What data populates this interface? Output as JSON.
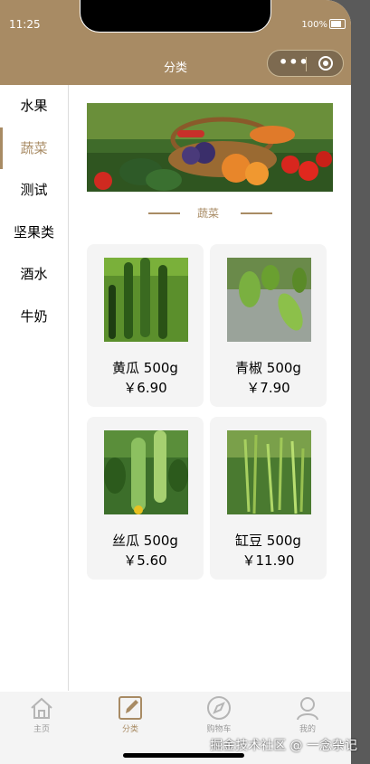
{
  "status_bar": {
    "time": "11:25",
    "battery": "100%"
  },
  "navbar": {
    "title": "分类",
    "more_glyph": "•••"
  },
  "sidebar": {
    "items": [
      {
        "label": "水果"
      },
      {
        "label": "蔬菜",
        "active": true
      },
      {
        "label": "测试"
      },
      {
        "label": "坚果类"
      },
      {
        "label": "酒水"
      },
      {
        "label": "牛奶"
      }
    ]
  },
  "section": {
    "title": "蔬菜"
  },
  "products": [
    {
      "name": "黄瓜 500g",
      "price": "￥6.90"
    },
    {
      "name": "青椒 500g",
      "price": "￥7.90"
    },
    {
      "name": "丝瓜 500g",
      "price": "￥5.60"
    },
    {
      "name": "缸豆 500g",
      "price": "￥11.90"
    }
  ],
  "tabbar": {
    "items": [
      {
        "label": "主页",
        "icon": "home-icon"
      },
      {
        "label": "分类",
        "icon": "edit-icon",
        "active": true
      },
      {
        "label": "购物车",
        "icon": "compass-icon"
      },
      {
        "label": "我的",
        "icon": "user-icon"
      }
    ]
  },
  "watermark": "掘金技术社区 @ 一念杂记",
  "colors": {
    "accent": "#a88b64",
    "card_bg": "#f4f4f4"
  }
}
